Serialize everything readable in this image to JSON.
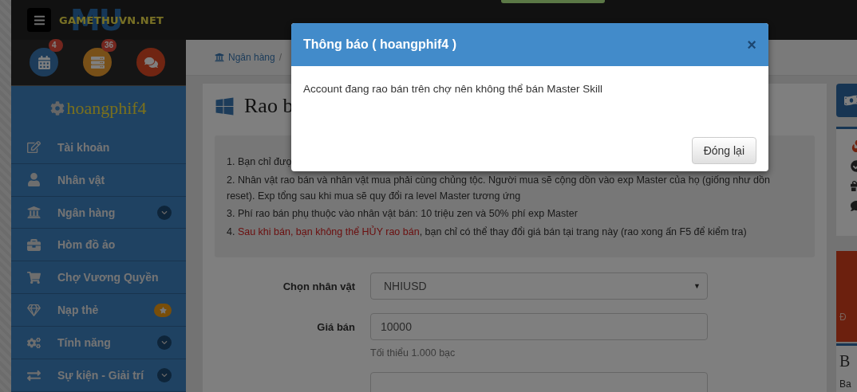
{
  "topbar": {
    "logo_text": "GAMETHUVN.NET",
    "logo_mark": "MU"
  },
  "quick_icons": [
    {
      "kind": "calendar",
      "badge": "4"
    },
    {
      "kind": "list",
      "badge": "36"
    },
    {
      "kind": "chat"
    }
  ],
  "user": {
    "name": "hoangphif4"
  },
  "menu": [
    {
      "kind": "account",
      "label": "Tài khoản",
      "has_submenu": false,
      "starred": false
    },
    {
      "kind": "character",
      "label": "Nhân vật",
      "has_submenu": false,
      "starred": false
    },
    {
      "kind": "bank",
      "label": "Ngân hàng",
      "has_submenu": true,
      "starred": false
    },
    {
      "kind": "chest",
      "label": "Hòm đồ ảo",
      "has_submenu": false,
      "starred": false
    },
    {
      "kind": "market",
      "label": "Chợ Vương Quyền",
      "has_submenu": false,
      "starred": false
    },
    {
      "kind": "topup",
      "label": "Nạp thẻ",
      "has_submenu": false,
      "starred": true
    },
    {
      "kind": "features",
      "label": "Tính năng",
      "has_submenu": true,
      "starred": false
    },
    {
      "kind": "events",
      "label": "Sự kiện - Giải trí",
      "has_submenu": true,
      "starred": false
    }
  ],
  "breadcrumb": {
    "items": [
      "Ngân hàng"
    ],
    "separator": "/"
  },
  "panel": {
    "title": "Rao b",
    "notes": [
      {
        "text": "1. Bạn chỉ đượ"
      },
      {
        "text": "2. Nhân vật rao bán và nhân vật mua phải cùng chủng tộc. Người mua sẽ cộng dồn vào exp Master của họ (giống như dồn reset). Exp tổng sau khi mua sẽ quy đổi ra level Master tương ứng"
      },
      {
        "text": "3. Phí rao bán phụ thuộc vào nhân vật bán: 10 triệu zen và 50% phí exp Master"
      },
      {
        "prefix": "4. ",
        "warning": "Sau khi bán, bạn không thể HỦY rao bán",
        "text": ", bạn chỉ có thể thay đổi giá bán tại trang này (rao xong ấn F5 để kiểm tra)"
      }
    ],
    "fields": [
      {
        "kind": "select",
        "label": "Chọn nhân vật",
        "value": "NHIUSD",
        "caret": "▼"
      },
      {
        "kind": "input",
        "label": "Giá bán",
        "value": "10000",
        "hint": "Tối thiểu 1.000 bạc"
      },
      {
        "kind": "input"
      }
    ]
  },
  "right": {
    "promo_text": "Đ",
    "card_title": "B",
    "card_text": "Ba"
  },
  "modal": {
    "title": "Thông báo ( hoangphif4 )",
    "close": "×",
    "message": "Account đang rao bán trên chợ nên không thể bán Master Skill",
    "button": "Đóng lại"
  }
}
